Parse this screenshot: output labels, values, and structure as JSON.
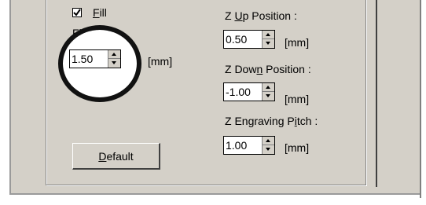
{
  "fill": {
    "label_prefix": "",
    "label_underline": "F",
    "label_suffix": "ill",
    "checked": true
  },
  "fill_pitch": {
    "label": "Fill Pitch",
    "value": "1.50",
    "unit": "[mm]"
  },
  "z_up": {
    "label_prefix": "Z ",
    "label_underline": "U",
    "label_suffix": "p Position :",
    "value": "0.50",
    "unit": "[mm]"
  },
  "z_down": {
    "label_prefix": "Z Dow",
    "label_underline": "n",
    "label_suffix": " Position :",
    "value": "-1.00",
    "unit": "[mm]"
  },
  "z_engraving_pitch": {
    "label_prefix": "Z Engraving P",
    "label_underline": "i",
    "label_suffix": "tch :",
    "value": "1.00",
    "unit": "[mm]"
  },
  "default_button": {
    "label_underline": "D",
    "label_suffix": "efault"
  }
}
